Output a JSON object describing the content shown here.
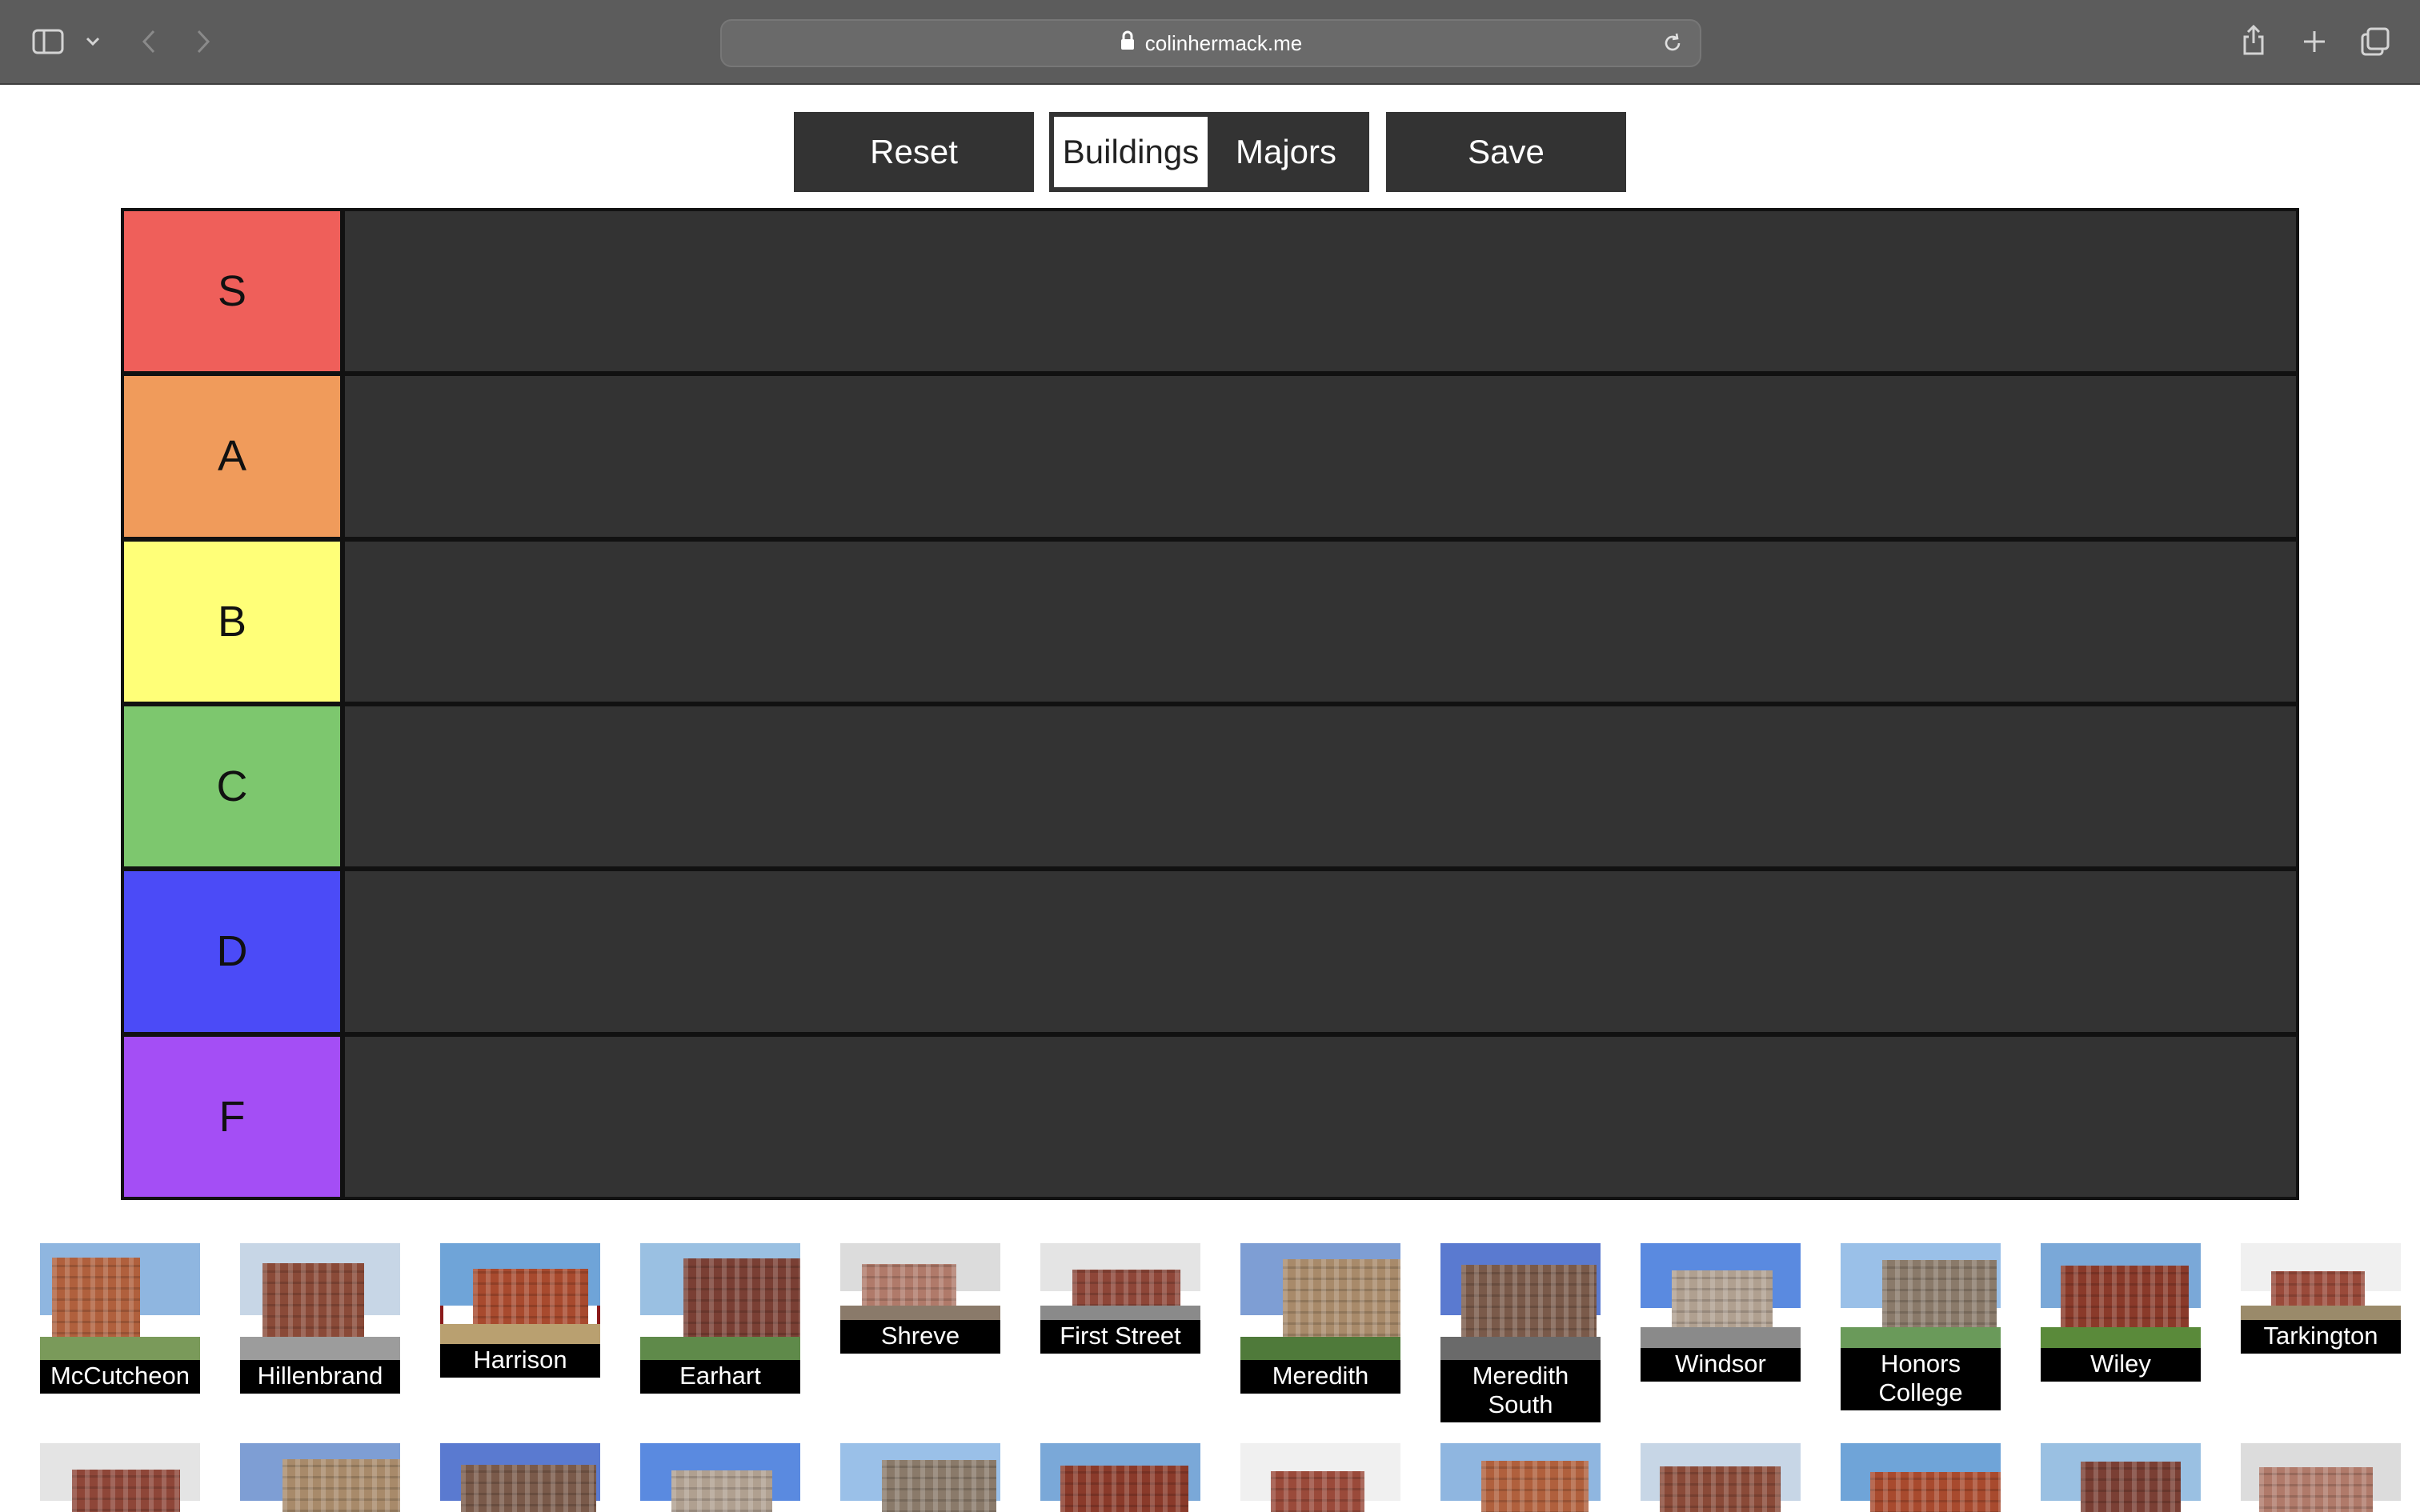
{
  "browser": {
    "url": "colinhermack.me",
    "icons": [
      "sidebar-icon",
      "chevron-down-icon",
      "back-icon",
      "forward-icon",
      "lock-icon",
      "reload-icon",
      "share-icon",
      "plus-icon",
      "tabs-icon"
    ]
  },
  "controls": {
    "reset_label": "Reset",
    "save_label": "Save",
    "toggle": {
      "options": [
        "Buildings",
        "Majors"
      ],
      "active": "Buildings"
    }
  },
  "tiers": [
    {
      "label": "S",
      "color": "#ef5f5a"
    },
    {
      "label": "A",
      "color": "#f09b5b"
    },
    {
      "label": "B",
      "color": "#ffff78"
    },
    {
      "label": "C",
      "color": "#7dc76e"
    },
    {
      "label": "D",
      "color": "#4b4bf7"
    },
    {
      "label": "F",
      "color": "#a44ef5"
    }
  ],
  "pool": {
    "selected": "Harrison",
    "items": [
      {
        "name": "McCutcheon"
      },
      {
        "name": "Hillenbrand"
      },
      {
        "name": "Harrison"
      },
      {
        "name": "Earhart"
      },
      {
        "name": "Shreve"
      },
      {
        "name": "First Street"
      },
      {
        "name": "Meredith"
      },
      {
        "name": "Meredith South"
      },
      {
        "name": "Windsor"
      },
      {
        "name": "Honors College"
      },
      {
        "name": "Wiley"
      },
      {
        "name": "Tarkington"
      }
    ],
    "second_row_count": 12
  }
}
